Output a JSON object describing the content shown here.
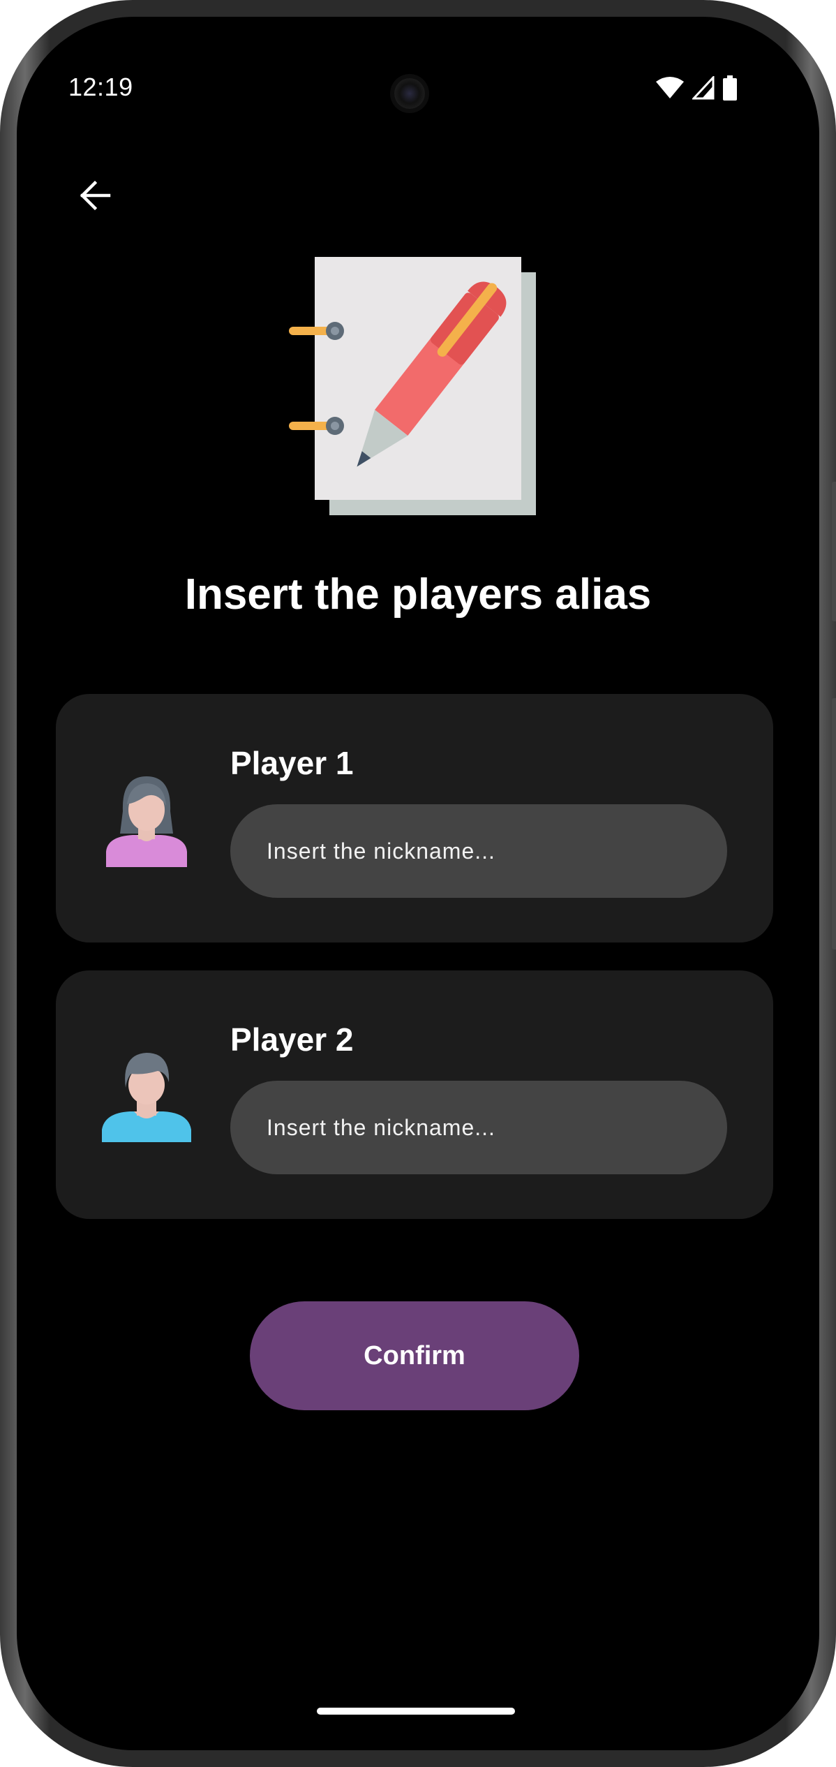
{
  "status_bar": {
    "time": "12:19",
    "icons": [
      "wifi-icon",
      "cellular-signal-icon",
      "battery-icon"
    ]
  },
  "toolbar": {
    "back_icon": "arrow-left-icon"
  },
  "hero": {
    "icon": "notebook-pencil-icon"
  },
  "title": "Insert the players alias",
  "players": [
    {
      "label": "Player 1",
      "avatar_icon": "woman-avatar-icon",
      "input_value": "",
      "placeholder": "Insert the nickname..."
    },
    {
      "label": "Player 2",
      "avatar_icon": "man-avatar-icon",
      "input_value": "",
      "placeholder": "Insert the nickname..."
    }
  ],
  "confirm_label": "Confirm",
  "colors": {
    "background": "#000000",
    "card": "#1c1c1c",
    "input": "#444444",
    "accent": "#6a4078",
    "text": "#ffffff"
  }
}
